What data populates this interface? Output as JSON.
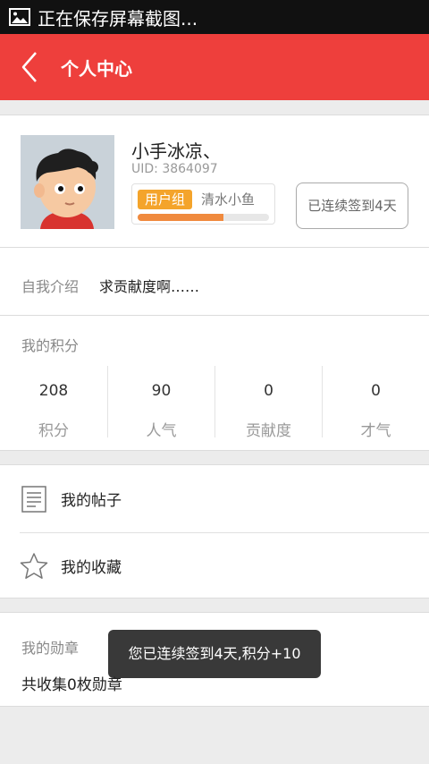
{
  "status_bar": {
    "text": "正在保存屏幕截图...",
    "icon": "image-icon"
  },
  "header": {
    "title": "个人中心",
    "back_icon": "back-arrow-icon",
    "background": "#ee3f3c"
  },
  "profile": {
    "username": "小手冰凉、",
    "uid": "UID: 3864097",
    "group_tag": "用户组",
    "group_name": "清水小鱼",
    "group_progress": 0.65,
    "checkin_label": "已连续签到4天"
  },
  "intro": {
    "label": "自我介绍",
    "text": "求贡献度啊……"
  },
  "points": {
    "title": "我的积分",
    "stats": [
      {
        "value": "208",
        "label": "积分"
      },
      {
        "value": "90",
        "label": "人气"
      },
      {
        "value": "0",
        "label": "贡献度"
      },
      {
        "value": "0",
        "label": "才气"
      }
    ]
  },
  "menu": [
    {
      "label": "我的帖子",
      "icon": "document-icon"
    },
    {
      "label": "我的收藏",
      "icon": "star-icon"
    }
  ],
  "medals": {
    "title": "我的勋章",
    "count_text": "共收集0枚勋章"
  },
  "toast": {
    "text": "您已连续签到4天,积分+10"
  }
}
